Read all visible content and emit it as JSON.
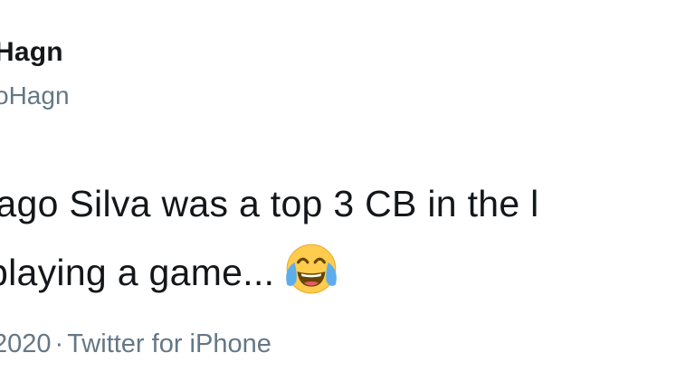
{
  "author": {
    "display_name": "Hagn",
    "handle": "oHagn"
  },
  "tweet": {
    "line1": "iago Silva was a top 3 CB in the l",
    "line2": "playing a game...",
    "emoji_icon": "face-with-tears-of-joy-icon"
  },
  "meta": {
    "date": "2020",
    "separator": "·",
    "source": "Twitter for iPhone"
  }
}
